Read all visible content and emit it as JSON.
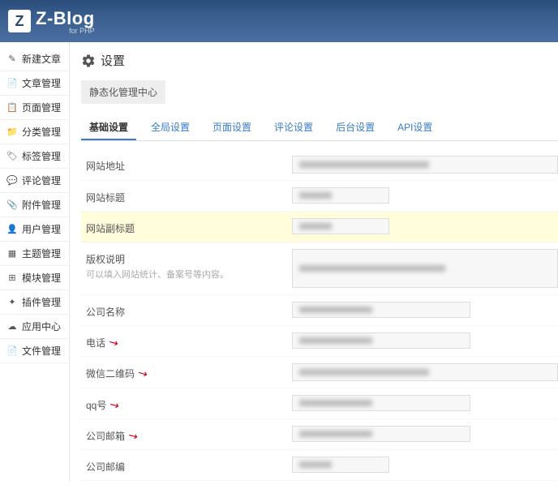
{
  "logo": {
    "badge": "Z",
    "text": "Z-Blog",
    "sub": "for PHP"
  },
  "sidebar": {
    "items": [
      {
        "icon": "✎",
        "label": "新建文章"
      },
      {
        "icon": "📄",
        "label": "文章管理"
      },
      {
        "icon": "📋",
        "label": "页面管理"
      },
      {
        "icon": "📁",
        "label": "分类管理"
      },
      {
        "icon": "🏷",
        "label": "标签管理"
      },
      {
        "icon": "💬",
        "label": "评论管理"
      },
      {
        "icon": "📎",
        "label": "附件管理"
      },
      {
        "icon": "👤",
        "label": "用户管理"
      },
      {
        "icon": "▦",
        "label": "主题管理"
      },
      {
        "icon": "⊞",
        "label": "模块管理"
      },
      {
        "icon": "✦",
        "label": "插件管理"
      },
      {
        "icon": "☁",
        "label": "应用中心"
      },
      {
        "icon": "📄",
        "label": "文件管理"
      }
    ]
  },
  "page": {
    "title": "设置",
    "subbtn": "静态化管理中心"
  },
  "tabs": [
    {
      "label": "基础设置",
      "active": true
    },
    {
      "label": "全局设置"
    },
    {
      "label": "页面设置"
    },
    {
      "label": "评论设置"
    },
    {
      "label": "后台设置"
    },
    {
      "label": "API设置"
    }
  ],
  "fields": [
    {
      "label": "网站地址",
      "type": "wide"
    },
    {
      "label": "网站标题",
      "type": "small"
    },
    {
      "label": "网站副标题",
      "type": "small",
      "highlight": true
    },
    {
      "label": "版权说明",
      "sub": "可以填入网站统计、备案号等内容。",
      "type": "tall"
    },
    {
      "label": "公司名称",
      "type": "med"
    },
    {
      "label": "电话",
      "type": "med",
      "arrow": true
    },
    {
      "label": "微信二维码",
      "type": "wide",
      "arrow": true
    },
    {
      "label": "qq号",
      "type": "med",
      "arrow": true
    },
    {
      "label": "公司邮箱",
      "type": "med",
      "arrow": true
    },
    {
      "label": "公司邮编",
      "type": "small"
    }
  ]
}
